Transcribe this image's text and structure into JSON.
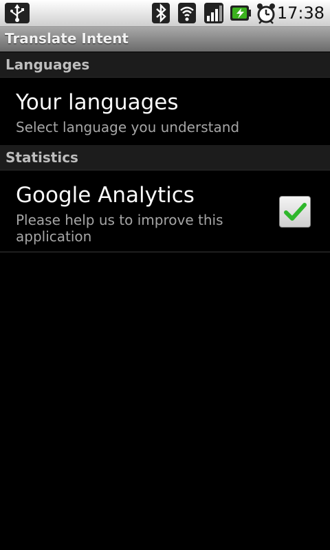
{
  "status_bar": {
    "time": "17:38",
    "icons": [
      "usb-icon",
      "bluetooth-icon",
      "wifi-icon",
      "signal-icon",
      "battery-charging-icon",
      "alarm-clock-icon"
    ]
  },
  "app": {
    "title": "Translate Intent"
  },
  "sections": [
    {
      "header": "Languages",
      "items": [
        {
          "title": "Your languages",
          "summary": "Select language you understand"
        }
      ]
    },
    {
      "header": "Statistics",
      "items": [
        {
          "title": "Google Analytics",
          "summary_line1": "Please help us to improve this",
          "summary_line2": "application",
          "checked": true
        }
      ]
    }
  ],
  "colors": {
    "checkmark": "#2fb72c",
    "battery_accent": "#3bb11e"
  }
}
